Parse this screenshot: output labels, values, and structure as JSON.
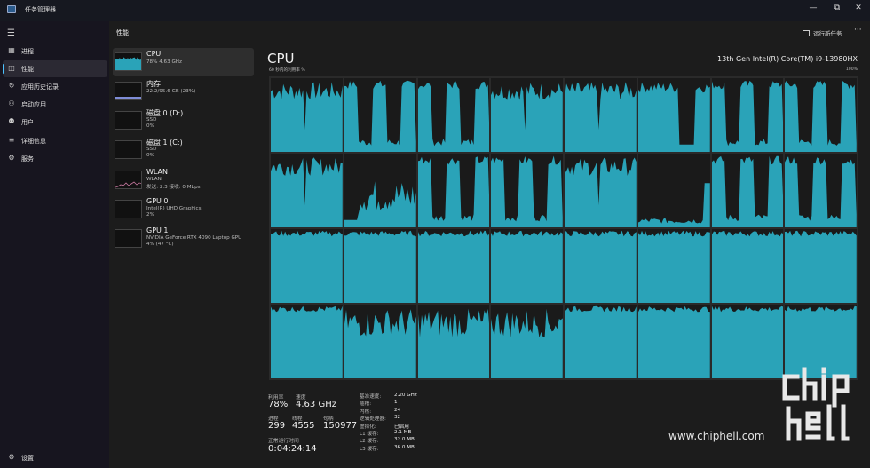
{
  "window": {
    "title": "任务管理器",
    "minimize": "—",
    "maximize": "⧉",
    "close": "✕"
  },
  "sidebar": {
    "menu_icon": "hamburger-icon",
    "items": [
      {
        "label": "进程",
        "icon": "processes-icon",
        "glyph": "▦"
      },
      {
        "label": "性能",
        "icon": "performance-icon",
        "glyph": "◫"
      },
      {
        "label": "应用历史记录",
        "icon": "history-icon",
        "glyph": "↻"
      },
      {
        "label": "启动应用",
        "icon": "startup-icon",
        "glyph": "⚇"
      },
      {
        "label": "用户",
        "icon": "users-icon",
        "glyph": "⚉"
      },
      {
        "label": "详细信息",
        "icon": "details-icon",
        "glyph": "≡"
      },
      {
        "label": "服务",
        "icon": "services-icon",
        "glyph": "⚙"
      }
    ],
    "settings": {
      "label": "设置",
      "icon": "settings-icon",
      "glyph": "⚙"
    }
  },
  "header": {
    "title": "性能",
    "run_task": "运行新任务",
    "more": "···"
  },
  "devices": [
    {
      "name": "CPU",
      "lines": [
        "78% 4.63 GHz"
      ],
      "color": "#2aa3b8"
    },
    {
      "name": "内存",
      "lines": [
        "22.2/95.6 GB (23%)"
      ],
      "color": "#7e8cd6"
    },
    {
      "name": "磁盘 0 (D:)",
      "lines": [
        "SSD",
        "0%"
      ],
      "color": "#4ec04e"
    },
    {
      "name": "磁盘 1 (C:)",
      "lines": [
        "SSD",
        "0%"
      ],
      "color": "#4ec04e"
    },
    {
      "name": "WLAN",
      "lines": [
        "WLAN",
        "发送: 2.3 接收: 0 Mbps"
      ],
      "color": "#c878a0"
    },
    {
      "name": "GPU 0",
      "lines": [
        "Intel(R) UHD Graphics",
        "2%"
      ],
      "color": "#3a7bd5"
    },
    {
      "name": "GPU 1",
      "lines": [
        "NVIDIA GeForce RTX 4090 Laptop GPU",
        "4% (47 °C)"
      ],
      "color": "#3a7bd5"
    }
  ],
  "cpu": {
    "title": "CPU",
    "model": "13th Gen Intel(R) Core(TM) i9-13980HX",
    "graph_caption": "60 秒内的利用率 %",
    "graph_max": "100%",
    "fill_color": "#2aa3b8"
  },
  "stats": {
    "utilization": {
      "label": "利用率",
      "value": "78%"
    },
    "speed": {
      "label": "速度",
      "value": "4.63 GHz"
    },
    "processes": {
      "label": "进程",
      "value": "299"
    },
    "threads": {
      "label": "线程",
      "value": "4555"
    },
    "handles": {
      "label": "句柄",
      "value": "150977"
    },
    "uptime": {
      "label": "正常运行时间",
      "value": "0:04:24:14"
    }
  },
  "specs": [
    {
      "label": "基准速度:",
      "value": "2.20 GHz"
    },
    {
      "label": "插槽:",
      "value": "1"
    },
    {
      "label": "内核:",
      "value": "24"
    },
    {
      "label": "逻辑处理器:",
      "value": "32"
    },
    {
      "label": "虚拟化:",
      "value": "已启用"
    },
    {
      "label": "L1 缓存:",
      "value": "2.1 MB"
    },
    {
      "label": "L2 缓存:",
      "value": "32.0 MB"
    },
    {
      "label": "L3 缓存:",
      "value": "36.0 MB"
    }
  ],
  "watermark": {
    "site": "www.chiphell.com",
    "logo": "chip hell"
  }
}
